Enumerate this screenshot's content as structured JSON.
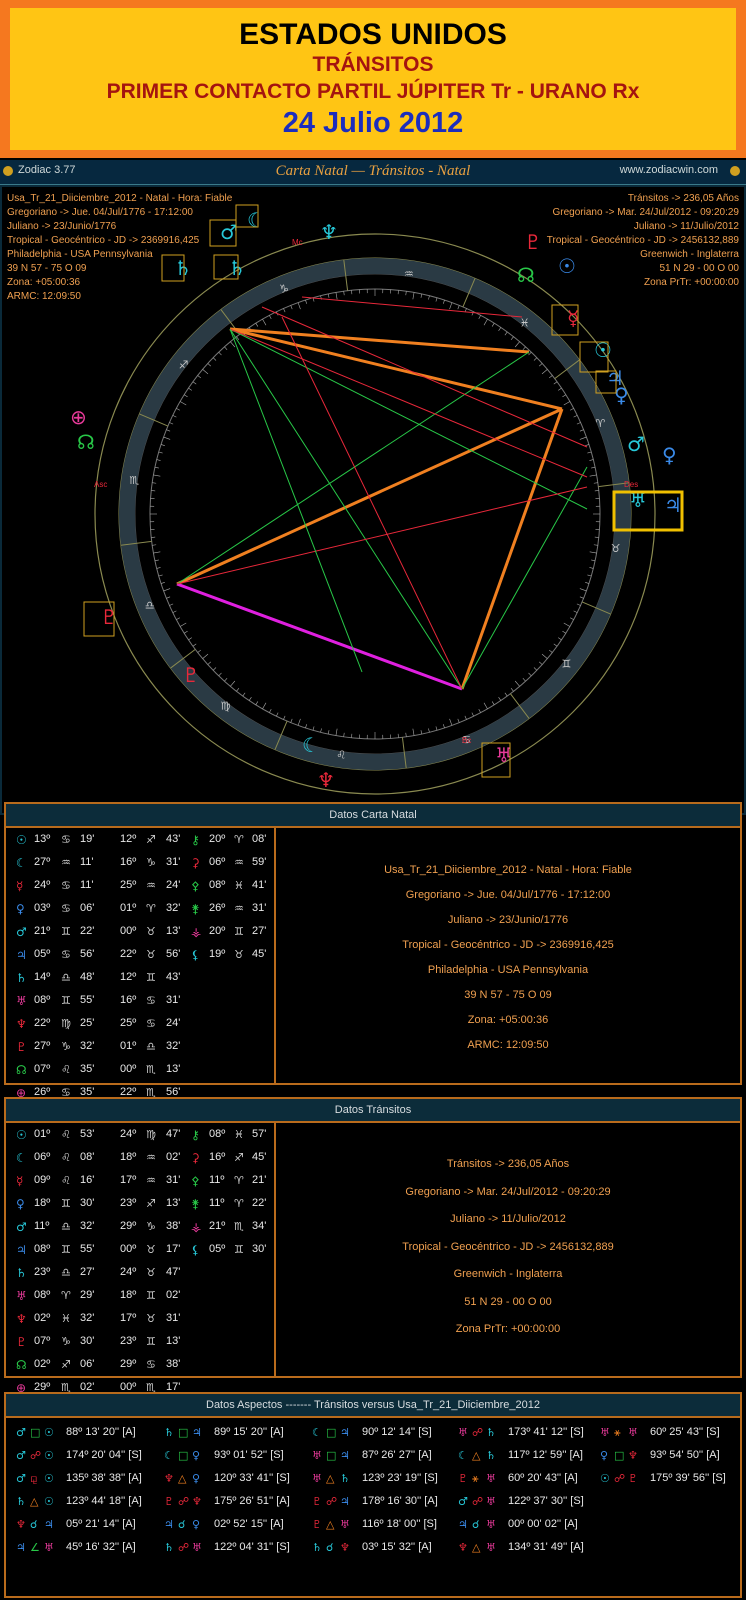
{
  "banner": {
    "line1": "ESTADOS UNIDOS",
    "line2": "TRÁNSITOS",
    "line3": "PRIMER CONTACTO PARTIL JÚPITER Tr - URANO Rx",
    "line4": "24 Julio 2012"
  },
  "titlebar": {
    "app": "Zodiac 3.77",
    "title": "Carta Natal — Tránsitos - Natal",
    "site": "www.zodiacwin.com"
  },
  "chart_info_left": [
    "Usa_Tr_21_Diiciembre_2012 - Natal - Hora: Fiable",
    "Gregoriano -> Jue. 04/Jul/1776 - 17:12:00",
    "Juliano -> 23/Junio/1776",
    "Tropical - Geocéntrico - JD -> 2369916,425",
    "Philadelphia - USA Pennsylvania",
    "39 N 57 - 75 O 09",
    "Zona: +05:00:36",
    "ARMC: 12:09:50"
  ],
  "chart_info_right": [
    "Tránsitos -> 236,05 Años",
    "Gregoriano -> Mar. 24/Jul/2012 - 09:20:29",
    "Juliano -> 11/Julio/2012",
    "Tropical - Geocéntrico - JD -> 2456132,889",
    "Greenwich - Inglaterra",
    "51 N 29 - 00 O 00",
    "Zona PrTr: +00:00:00"
  ],
  "chart_labels": {
    "mc": "Mc",
    "asc": "Asc",
    "des": "Des",
    "bc": "Bc"
  },
  "natal": {
    "header": "Datos Carta Natal",
    "rows": [
      {
        "p": "☉",
        "pc": "cyan",
        "d": "13º",
        "s": "♋",
        "sc": "grey",
        "m": "19'"
      },
      {
        "p": "☾",
        "pc": "cyan",
        "d": "27º",
        "s": "♒",
        "sc": "grey",
        "m": "11'"
      },
      {
        "p": "☿",
        "pc": "red",
        "d": "24º",
        "s": "♋",
        "sc": "grey",
        "m": "11'"
      },
      {
        "p": "♀",
        "pc": "blue",
        "d": "03º",
        "s": "♋",
        "sc": "grey",
        "m": "06'"
      },
      {
        "p": "♂",
        "pc": "cyan",
        "d": "21º",
        "s": "♊",
        "sc": "grey",
        "m": "22'"
      },
      {
        "p": "♃",
        "pc": "blue",
        "d": "05º",
        "s": "♋",
        "sc": "grey",
        "m": "56'"
      },
      {
        "p": "♄",
        "pc": "cyan",
        "d": "14º",
        "s": "♎",
        "sc": "grey",
        "m": "48'"
      },
      {
        "p": "♅",
        "pc": "pink",
        "d": "08º",
        "s": "♊",
        "sc": "grey",
        "m": "55'"
      },
      {
        "p": "♆",
        "pc": "red",
        "d": "22º",
        "s": "♍",
        "sc": "grey",
        "m": "25'"
      },
      {
        "p": "♇",
        "pc": "red",
        "d": "27º",
        "s": "♑",
        "sc": "grey",
        "m": "32'"
      },
      {
        "p": "☊",
        "pc": "green",
        "d": "07º",
        "s": "♌",
        "sc": "grey",
        "m": "35'"
      },
      {
        "p": "⊕",
        "pc": "pink",
        "d": "26º",
        "s": "♋",
        "sc": "grey",
        "m": "35'"
      }
    ],
    "col2": [
      {
        "d": "12º",
        "s": "♐",
        "m": "43'"
      },
      {
        "d": "16º",
        "s": "♑",
        "m": "31'"
      },
      {
        "d": "25º",
        "s": "♒",
        "m": "24'"
      },
      {
        "d": "01º",
        "s": "♈",
        "m": "32'"
      },
      {
        "d": "00º",
        "s": "♉",
        "m": "13'"
      },
      {
        "d": "22º",
        "s": "♉",
        "m": "56'"
      },
      {
        "d": "12º",
        "s": "♊",
        "m": "43'"
      },
      {
        "d": "16º",
        "s": "♋",
        "m": "31'"
      },
      {
        "d": "25º",
        "s": "♋",
        "m": "24'"
      },
      {
        "d": "01º",
        "s": "♎",
        "m": "32'"
      },
      {
        "d": "00º",
        "s": "♏",
        "m": "13'"
      },
      {
        "d": "22º",
        "s": "♏",
        "m": "56'"
      }
    ],
    "col3": [
      {
        "p": "⚷",
        "pc": "green",
        "d": "20º",
        "s": "♈",
        "m": "08'"
      },
      {
        "p": "⚳",
        "pc": "red",
        "d": "06º",
        "s": "♒",
        "m": "59'"
      },
      {
        "p": "⚴",
        "pc": "green",
        "d": "08º",
        "s": "♓",
        "m": "41'"
      },
      {
        "p": "⚵",
        "pc": "green",
        "d": "26º",
        "s": "♒",
        "m": "31'"
      },
      {
        "p": "⚶",
        "pc": "pink",
        "d": "20º",
        "s": "♊",
        "m": "27'"
      },
      {
        "p": "⚸",
        "pc": "cyan",
        "d": "19º",
        "s": "♉",
        "m": "45'"
      }
    ],
    "details": [
      "Usa_Tr_21_Diiciembre_2012 - Natal - Hora: Fiable",
      "Gregoriano -> Jue. 04/Jul/1776 - 17:12:00",
      "Juliano -> 23/Junio/1776",
      "Tropical - Geocéntrico - JD -> 2369916,425",
      "Philadelphia - USA Pennsylvania",
      "39 N 57 - 75 O 09",
      "Zona: +05:00:36",
      "ARMC: 12:09:50"
    ]
  },
  "transits": {
    "header": "Datos Tránsitos",
    "rows": [
      {
        "p": "☉",
        "pc": "cyan",
        "d": "01º",
        "s": "♌",
        "m": "53'"
      },
      {
        "p": "☾",
        "pc": "cyan",
        "d": "06º",
        "s": "♌",
        "m": "08'"
      },
      {
        "p": "☿",
        "pc": "red",
        "d": "09º",
        "s": "♌",
        "m": "16'"
      },
      {
        "p": "♀",
        "pc": "blue",
        "d": "18º",
        "s": "♊",
        "m": "30'"
      },
      {
        "p": "♂",
        "pc": "cyan",
        "d": "11º",
        "s": "♎",
        "m": "32'"
      },
      {
        "p": "♃",
        "pc": "blue",
        "d": "08º",
        "s": "♊",
        "m": "55'"
      },
      {
        "p": "♄",
        "pc": "cyan",
        "d": "23º",
        "s": "♎",
        "m": "27'"
      },
      {
        "p": "♅",
        "pc": "pink",
        "d": "08º",
        "s": "♈",
        "m": "29'"
      },
      {
        "p": "♆",
        "pc": "red",
        "d": "02º",
        "s": "♓",
        "m": "32'"
      },
      {
        "p": "♇",
        "pc": "red",
        "d": "07º",
        "s": "♑",
        "m": "30'"
      },
      {
        "p": "☊",
        "pc": "green",
        "d": "02º",
        "s": "♐",
        "m": "06'"
      },
      {
        "p": "⊕",
        "pc": "pink",
        "d": "29º",
        "s": "♏",
        "m": "02'"
      }
    ],
    "col2": [
      {
        "d": "24º",
        "s": "♍",
        "m": "47'"
      },
      {
        "d": "18º",
        "s": "♒",
        "m": "02'"
      },
      {
        "d": "17º",
        "s": "♒",
        "m": "31'"
      },
      {
        "d": "23º",
        "s": "♐",
        "m": "13'"
      },
      {
        "d": "29º",
        "s": "♑",
        "m": "38'"
      },
      {
        "d": "00º",
        "s": "♉",
        "m": "17'"
      },
      {
        "d": "24º",
        "s": "♉",
        "m": "47'"
      },
      {
        "d": "18º",
        "s": "♊",
        "m": "02'"
      },
      {
        "d": "17º",
        "s": "♉",
        "m": "31'"
      },
      {
        "d": "23º",
        "s": "♊",
        "m": "13'"
      },
      {
        "d": "29º",
        "s": "♋",
        "m": "38'"
      },
      {
        "d": "00º",
        "s": "♏",
        "m": "17'"
      }
    ],
    "col3": [
      {
        "p": "⚷",
        "pc": "green",
        "d": "08º",
        "s": "♓",
        "m": "57'"
      },
      {
        "p": "⚳",
        "pc": "red",
        "d": "16º",
        "s": "♐",
        "m": "45'"
      },
      {
        "p": "⚴",
        "pc": "green",
        "d": "11º",
        "s": "♈",
        "m": "21'"
      },
      {
        "p": "⚵",
        "pc": "green",
        "d": "11º",
        "s": "♈",
        "m": "22'"
      },
      {
        "p": "⚶",
        "pc": "pink",
        "d": "21º",
        "s": "♏",
        "m": "34'"
      },
      {
        "p": "⚸",
        "pc": "cyan",
        "d": "05º",
        "s": "♊",
        "m": "30'"
      }
    ],
    "details": [
      "Tránsitos -> 236,05 Años",
      "Gregoriano -> Mar. 24/Jul/2012 - 09:20:29",
      "Juliano -> 11/Julio/2012",
      "Tropical - Geocéntrico - JD -> 2456132,889",
      "Greenwich - Inglaterra",
      "51 N 29 - 00 O 00",
      "Zona PrTr: +00:00:00"
    ]
  },
  "aspects": {
    "header": "Datos Aspectos ------- Tránsitos versus Usa_Tr_21_Diiciembre_2012",
    "rows": [
      [
        {
          "a": "♂",
          "ac": "cyan",
          "x": "□",
          "xc": "green",
          "b": "☉",
          "bc": "cyan",
          "v": "88º 13' 20'' [A]"
        },
        {
          "a": "♄",
          "ac": "cyan",
          "x": "□",
          "xc": "green",
          "b": "♃",
          "bc": "blue",
          "v": "89º 15' 20'' [A]"
        },
        {
          "a": "☾",
          "ac": "cyan",
          "x": "□",
          "xc": "green",
          "b": "♃",
          "bc": "blue",
          "v": "90º 12' 14'' [S]"
        },
        {
          "a": "♅",
          "ac": "pink",
          "x": "☍",
          "xc": "red",
          "b": "♄",
          "bc": "cyan",
          "v": "173º 41' 12'' [S]"
        },
        {
          "a": "♅",
          "ac": "pink",
          "x": "⚹",
          "xc": "orange",
          "b": "♅",
          "bc": "pink",
          "v": "60º 25' 43'' [S]"
        }
      ],
      [
        {
          "a": "♂",
          "ac": "cyan",
          "x": "☍",
          "xc": "red",
          "b": "☉",
          "bc": "cyan",
          "v": "174º 20' 04'' [S]"
        },
        {
          "a": "☾",
          "ac": "cyan",
          "x": "□",
          "xc": "green",
          "b": "♀",
          "bc": "blue",
          "v": "93º 01' 52'' [S]"
        },
        {
          "a": "♅",
          "ac": "pink",
          "x": "□",
          "xc": "green",
          "b": "♃",
          "bc": "blue",
          "v": "87º 26' 27'' [A]"
        },
        {
          "a": "☾",
          "ac": "cyan",
          "x": "△",
          "xc": "orange",
          "b": "♄",
          "bc": "cyan",
          "v": "117º 12' 59'' [A]"
        },
        {
          "a": "♀",
          "ac": "blue",
          "x": "□",
          "xc": "green",
          "b": "♆",
          "bc": "red",
          "v": "93º 54' 50'' [A]"
        }
      ],
      [
        {
          "a": "♂",
          "ac": "cyan",
          "x": "⚼",
          "xc": "red",
          "b": "☉",
          "bc": "cyan",
          "v": "135º 38' 38'' [A]"
        },
        {
          "a": "♆",
          "ac": "red",
          "x": "△",
          "xc": "orange",
          "b": "♀",
          "bc": "blue",
          "v": "120º 33' 41'' [S]"
        },
        {
          "a": "♅",
          "ac": "pink",
          "x": "△",
          "xc": "orange",
          "b": "♄",
          "bc": "cyan",
          "v": "123º 23' 19'' [S]"
        },
        {
          "a": "♇",
          "ac": "red",
          "x": "⚹",
          "xc": "orange",
          "b": "♅",
          "bc": "pink",
          "v": "60º 20' 43'' [A]"
        },
        {
          "a": "☉",
          "ac": "cyan",
          "x": "☍",
          "xc": "red",
          "b": "♇",
          "bc": "red",
          "v": "175º 39' 56'' [S]"
        }
      ],
      [
        {
          "a": "♄",
          "ac": "cyan",
          "x": "△",
          "xc": "orange",
          "b": "☉",
          "bc": "cyan",
          "v": "123º 44' 18'' [A]"
        },
        {
          "a": "♇",
          "ac": "red",
          "x": "☍",
          "xc": "red",
          "b": "♆",
          "bc": "red",
          "v": "175º 26' 51'' [A]"
        },
        {
          "a": "♇",
          "ac": "red",
          "x": "☍",
          "xc": "red",
          "b": "♃",
          "bc": "blue",
          "v": "178º 16' 30'' [A]"
        },
        {
          "a": "♂",
          "ac": "cyan",
          "x": "☍",
          "xc": "red",
          "b": "♅",
          "bc": "pink",
          "v": "122º 37' 30'' [S]"
        }
      ],
      [
        {
          "a": "♆",
          "ac": "red",
          "x": "☌",
          "xc": "cyan",
          "b": "♃",
          "bc": "blue",
          "v": "05º 21' 14'' [A]"
        },
        {
          "a": "♃",
          "ac": "blue",
          "x": "☌",
          "xc": "cyan",
          "b": "♀",
          "bc": "blue",
          "v": "02º 52' 15'' [A]"
        },
        {
          "a": "♇",
          "ac": "red",
          "x": "△",
          "xc": "orange",
          "b": "♅",
          "bc": "pink",
          "v": "116º 18' 00'' [S]"
        },
        {
          "a": "♃",
          "ac": "blue",
          "x": "☌",
          "xc": "cyan",
          "b": "♅",
          "bc": "pink",
          "v": "00º 00' 02'' [A]"
        }
      ],
      [
        {
          "a": "♃",
          "ac": "blue",
          "x": "∠",
          "xc": "green",
          "b": "♅",
          "bc": "pink",
          "v": "45º 16' 32'' [A]"
        },
        {
          "a": "♄",
          "ac": "cyan",
          "x": "☍",
          "xc": "red",
          "b": "♅",
          "bc": "pink",
          "v": "122º 04' 31'' [S]"
        },
        {
          "a": "♄",
          "ac": "cyan",
          "x": "☌",
          "xc": "cyan",
          "b": "♆",
          "bc": "red",
          "v": "03º 15' 32'' [A]"
        },
        {
          "a": "♆",
          "ac": "red",
          "x": "△",
          "xc": "orange",
          "b": "♅",
          "bc": "pink",
          "v": "134º 31' 49'' [A]"
        }
      ]
    ]
  },
  "colors": {
    "banner_outer": "#f5781f",
    "banner_inner": "#ffc514",
    "panel_border": "#b96b1c",
    "accent_info": "#f0a050"
  }
}
